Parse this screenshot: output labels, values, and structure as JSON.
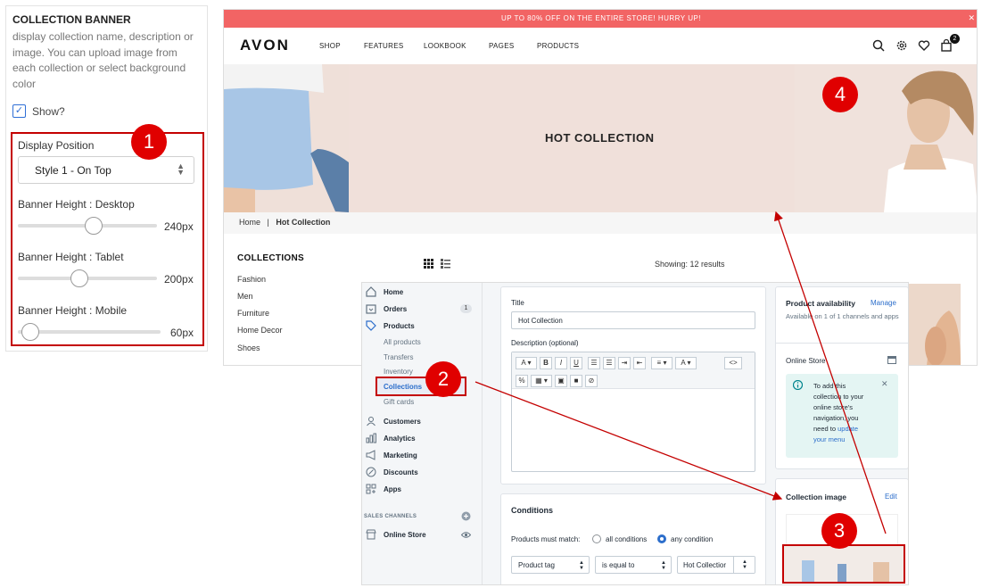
{
  "settings": {
    "title": "COLLECTION BANNER",
    "description": "display collection name, description or image. You can upload image from each collection or select background color",
    "show_label": "Show?",
    "show_checked": true,
    "display_position_label": "Display Position",
    "display_position_value": "Style 1 - On Top",
    "sliders": [
      {
        "label": "Banner Height : Desktop",
        "value": "240px"
      },
      {
        "label": "Banner Height : Tablet",
        "value": "200px"
      },
      {
        "label": "Banner Height : Mobile",
        "value": "60px"
      }
    ]
  },
  "store": {
    "promo": "UP TO 80% OFF ON THE ENTIRE STORE! HURRY UP!",
    "logo": "AVON",
    "nav": [
      "SHOP",
      "FEATURES",
      "LOOKBOOK",
      "PAGES",
      "PRODUCTS"
    ],
    "cart_count": "2",
    "banner_title": "HOT COLLECTION",
    "breadcrumb": {
      "home": "Home",
      "sep": "|",
      "current": "Hot Collection"
    },
    "collections_title": "COLLECTIONS",
    "collections": [
      "Fashion",
      "Men",
      "Furniture",
      "Home Decor",
      "Shoes"
    ],
    "showing": "Showing: 12 results"
  },
  "admin": {
    "nav": [
      {
        "label": "Home"
      },
      {
        "label": "Orders",
        "badge": "1"
      },
      {
        "label": "Products"
      }
    ],
    "product_sub": [
      "All products",
      "Transfers",
      "Inventory",
      "Collections",
      "Gift cards"
    ],
    "nav2": [
      "Customers",
      "Analytics",
      "Marketing",
      "Discounts",
      "Apps"
    ],
    "sales_channels": "SALES CHANNELS",
    "online_store": "Online Store",
    "title_label": "Title",
    "title_value": "Hot Collection",
    "desc_label": "Description (optional)",
    "conditions_title": "Conditions",
    "match_label": "Products must match:",
    "match_all": "all conditions",
    "match_any": "any condition",
    "cond_field": "Product tag",
    "cond_op": "is equal to",
    "cond_value": "Hot Collectior",
    "availability_title": "Product availability",
    "manage": "Manage",
    "availability_text": "Available on 1 of 1 channels and apps",
    "online_store_label": "Online Store",
    "info_text": "To add this collection to your online store's navigation, you need to",
    "info_link": "update your menu",
    "collection_image": "Collection image",
    "edit": "Edit"
  },
  "callouts": [
    "1",
    "2",
    "3",
    "4"
  ],
  "colors": {
    "accent": "#c40000",
    "badge": "#e00000",
    "promo": "#f26464",
    "link": "#2c6ecb"
  }
}
